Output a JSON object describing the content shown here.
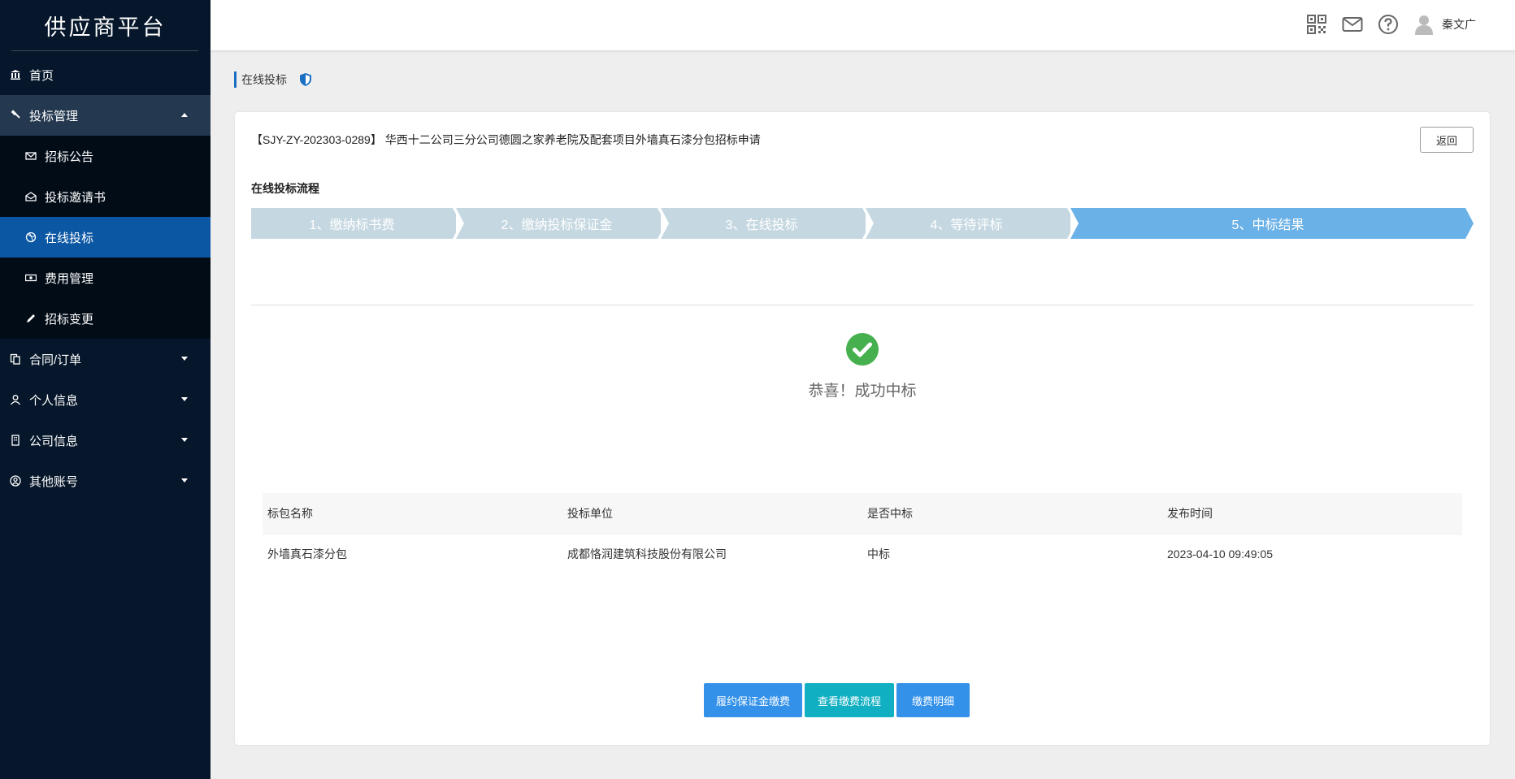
{
  "app": {
    "title": "供应商平台"
  },
  "sidebar": {
    "items": [
      {
        "label": "首页",
        "icon": "bank-icon"
      },
      {
        "label": "投标管理",
        "icon": "gavel-icon",
        "open": true,
        "children": [
          {
            "label": "招标公告",
            "icon": "envelope-icon"
          },
          {
            "label": "投标邀请书",
            "icon": "envelope-open-icon"
          },
          {
            "label": "在线投标",
            "icon": "dribbble-icon",
            "active": true
          },
          {
            "label": "费用管理",
            "icon": "money-icon"
          },
          {
            "label": "招标变更",
            "icon": "pencil-icon"
          }
        ]
      },
      {
        "label": "合同/订单",
        "icon": "copy-icon"
      },
      {
        "label": "个人信息",
        "icon": "user-icon"
      },
      {
        "label": "公司信息",
        "icon": "building-icon"
      },
      {
        "label": "其他账号",
        "icon": "user-circle-icon"
      }
    ]
  },
  "header": {
    "icons": [
      "qrcode-icon",
      "mail-icon",
      "help-icon",
      "avatar-icon"
    ],
    "user_name": "秦文广"
  },
  "breadcrumb": {
    "label": "在线投标"
  },
  "main": {
    "project_title": "【SJY-ZY-202303-0289】 华西十二公司三分公司德圆之家养老院及配套项目外墙真石漆分包招标申请",
    "back_label": "返回",
    "flow_title": "在线投标流程",
    "steps": [
      {
        "label": "1、缴纳标书费",
        "active": false
      },
      {
        "label": "2、缴纳投标保证金",
        "active": false
      },
      {
        "label": "3、在线投标",
        "active": false
      },
      {
        "label": "4、等待评标",
        "active": false
      },
      {
        "label": "5、中标结果",
        "active": true
      }
    ],
    "result_text": "恭喜！成功中标",
    "table": {
      "headers": [
        "标包名称",
        "投标单位",
        "是否中标",
        "发布时间"
      ],
      "rows": [
        [
          "外墙真石漆分包",
          "成都恪润建筑科技股份有限公司",
          "中标",
          "2023-04-10 09:49:05"
        ]
      ]
    },
    "buttons": [
      {
        "label": "履约保证金缴费",
        "color": "#3391e9"
      },
      {
        "label": "查看缴费流程",
        "color": "#11afc2"
      },
      {
        "label": "缴费明细",
        "color": "#3391e9"
      }
    ]
  },
  "colors": {
    "sidebar_bg": "#06172b",
    "active_item": "#0b57a4",
    "step_inactive": "#c5d8e1",
    "step_active": "#6ab1e7",
    "success_green": "#46b04f"
  }
}
